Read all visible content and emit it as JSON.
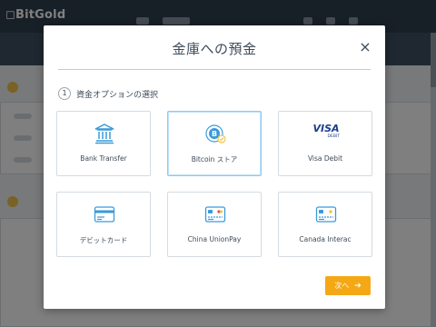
{
  "app": {
    "logo": "BitGold"
  },
  "modal": {
    "title": "金庫への預金",
    "close_label": "×",
    "step": {
      "number": "1",
      "label": "資金オプションの選択"
    },
    "options": [
      {
        "label": "Bank Transfer",
        "icon": "bank-icon",
        "selected": false
      },
      {
        "label": "Bitcoin ストア",
        "icon": "bitcoin-icon",
        "selected": true
      },
      {
        "label": "Visa Debit",
        "icon": "visa-debit-icon",
        "selected": false,
        "logo_text": "VISA",
        "logo_subtext": "DEBIT"
      },
      {
        "label": "デビットカード",
        "icon": "debit-card-icon",
        "selected": false
      },
      {
        "label": "China UnionPay",
        "icon": "unionpay-card-icon",
        "selected": false
      },
      {
        "label": "Canada Interac",
        "icon": "interac-card-icon",
        "selected": false
      }
    ],
    "next_label": "次へ",
    "next_arrow": "➔"
  },
  "colors": {
    "accent": "#f5a815",
    "icon_blue": "#3a9ad9",
    "text": "#3d4b59",
    "gold": "#f2c54b"
  }
}
